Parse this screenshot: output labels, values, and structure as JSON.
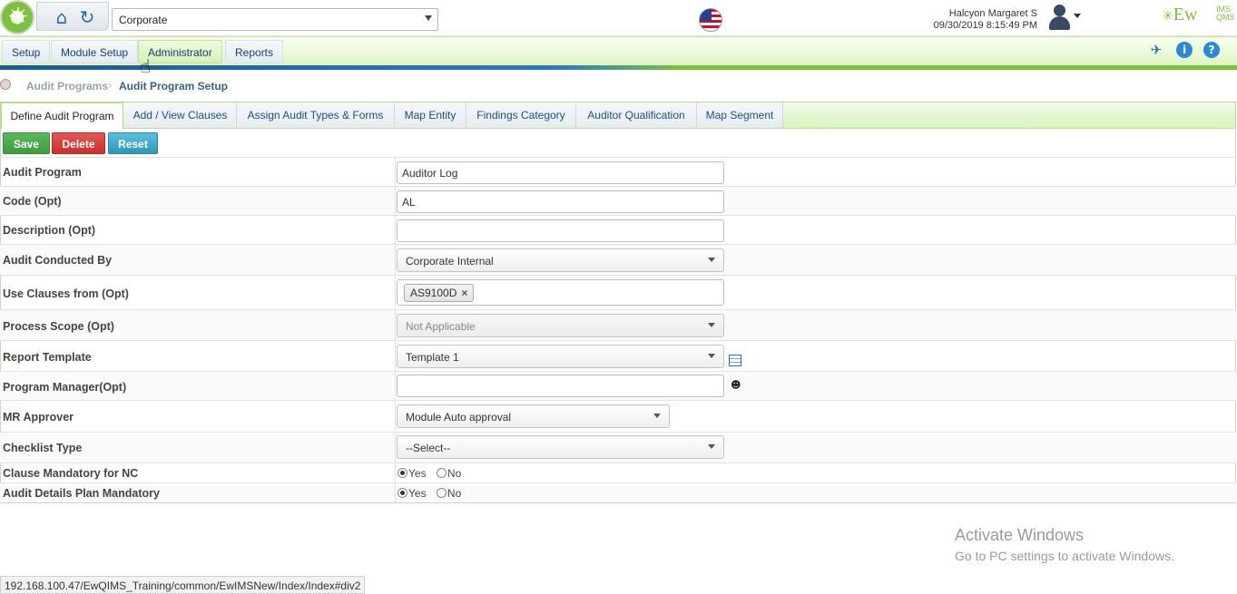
{
  "header": {
    "site_selected": "Corporate",
    "user_name": "Halcyon Margaret S",
    "datetime": "09/30/2019 8:15:49 PM",
    "brand": "Ew",
    "brand_sub_top": "IMS",
    "brand_sub_bottom": "QMS",
    "brand_color": "#7cc142"
  },
  "menu": {
    "items": [
      "Setup",
      "Module Setup",
      "Administrator",
      "Reports"
    ],
    "active": "Administrator",
    "right_icons": [
      "pin-icon",
      "info-icon",
      "help-icon"
    ]
  },
  "breadcrumb": {
    "parent": "Audit Programs",
    "current": "Audit Program Setup"
  },
  "tabs": [
    "Define Audit Program",
    "Add / View Clauses",
    "Assign Audit Types & Forms",
    "Map Entity",
    "Findings Category",
    "Auditor Qualification",
    "Map Segment"
  ],
  "actions": {
    "save": "Save",
    "delete": "Delete",
    "reset": "Reset"
  },
  "form": {
    "audit_program": {
      "label": "Audit Program",
      "value": "Auditor Log"
    },
    "code": {
      "label": "Code (Opt)",
      "value": "AL"
    },
    "description": {
      "label": "Description (Opt)",
      "value": ""
    },
    "conducted_by": {
      "label": "Audit Conducted By",
      "value": "Corporate Internal"
    },
    "clauses_from": {
      "label": "Use Clauses from (Opt)",
      "tag": "AS9100D",
      "tag_remove": "×"
    },
    "process_scope": {
      "label": "Process Scope (Opt)",
      "value": "Not Applicable"
    },
    "report_template": {
      "label": "Report Template",
      "value": "Template 1"
    },
    "program_manager": {
      "label": "Program Manager(Opt)",
      "value": ""
    },
    "mr_approver": {
      "label": "MR Approver",
      "value": "Module Auto approval"
    },
    "checklist_type": {
      "label": "Checklist Type",
      "value": "--Select--"
    },
    "clause_mandatory": {
      "label": "Clause Mandatory for NC",
      "yes": "Yes",
      "no": "No",
      "selected": "Yes"
    },
    "plan_mandatory": {
      "label": "Audit Details Plan Mandatory",
      "yes": "Yes",
      "no": "No",
      "selected": "Yes"
    }
  },
  "watermark": {
    "title": "Activate Windows",
    "subtitle": "Go to PC settings to activate Windows."
  },
  "status_url": "192.168.100.47/EwQIMS_Training/common/EwIMSNew/Index/Index#div2"
}
